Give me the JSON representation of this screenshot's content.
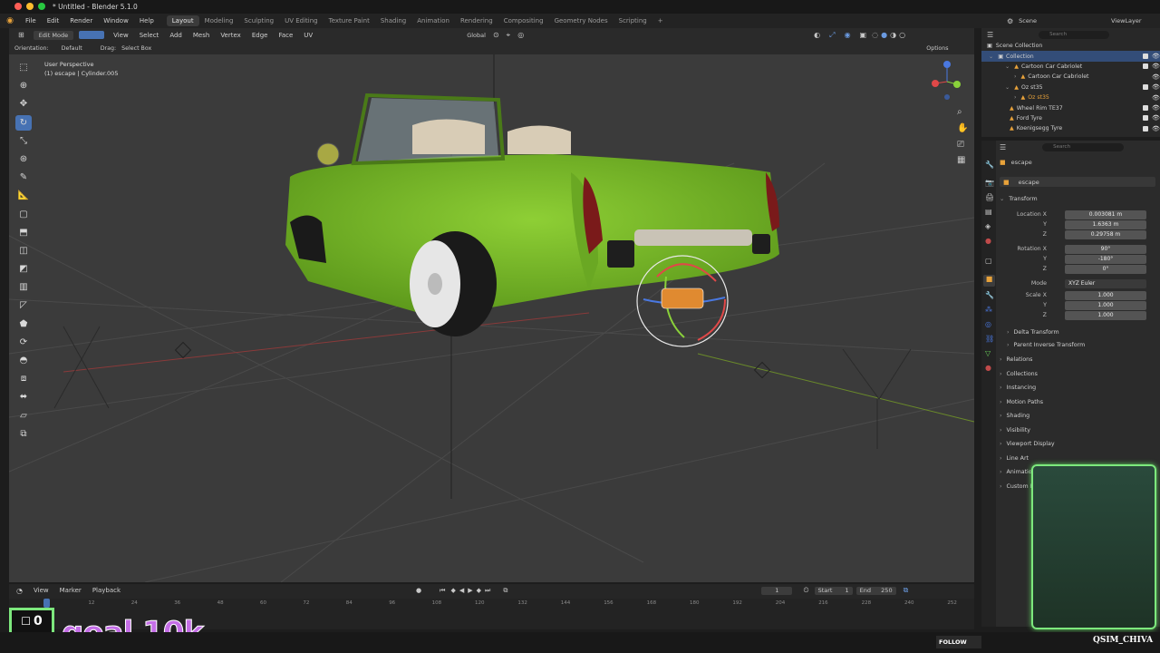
{
  "window": {
    "title": "* Untitled - Blender 5.1.0"
  },
  "menubar": {
    "menus": [
      "File",
      "Edit",
      "Render",
      "Window",
      "Help"
    ],
    "workspaces": [
      "Layout",
      "Modeling",
      "Sculpting",
      "UV Editing",
      "Texture Paint",
      "Shading",
      "Animation",
      "Rendering",
      "Compositing",
      "Geometry Nodes",
      "Scripting"
    ],
    "active_workspace": "Layout",
    "add_tab": "+",
    "scene": "Scene",
    "view_layer": "ViewLayer"
  },
  "viewport_header": {
    "mode": "Edit Mode",
    "menus": [
      "View",
      "Select",
      "Add",
      "Mesh",
      "Vertex",
      "Edge",
      "Face",
      "UV"
    ],
    "orientation": "Global",
    "orientation_label": "Orientation:",
    "orientation_value": "Default",
    "drag_label": "Drag:",
    "drag_value": "Select Box",
    "options": "Options"
  },
  "viewport": {
    "perspective": "User Perspective",
    "object_info": "(1) escape | Cylinder.005",
    "colors": {
      "background": "#3b3b3b",
      "car": "#7ab82a"
    }
  },
  "outliner": {
    "search_placeholder": "Search",
    "root": "Scene Collection",
    "items": [
      {
        "label": "Collection",
        "level": 0,
        "icon": "collection-icon"
      },
      {
        "label": "Cartoon Car Cabriolet",
        "level": 1,
        "icon": "object-icon"
      },
      {
        "label": "Cartoon Car Cabriolet",
        "level": 2,
        "icon": "mesh-icon"
      },
      {
        "label": "Oz st35",
        "level": 1,
        "icon": "object-icon"
      },
      {
        "label": "Oz st35",
        "level": 2,
        "icon": "mesh-icon"
      },
      {
        "label": "Wheel Rim TE37",
        "level": 1,
        "icon": "object-icon"
      },
      {
        "label": "Ford Tyre",
        "level": 1,
        "icon": "object-icon"
      },
      {
        "label": "Koenigsegg Tyre",
        "level": 1,
        "icon": "object-icon"
      }
    ]
  },
  "properties": {
    "search_placeholder": "Search",
    "object_name": "escape",
    "object_field": "escape",
    "transform": {
      "title": "Transform",
      "location_label": "Location X",
      "location": [
        "0.003081 m",
        "1.6363 m",
        "0.29758 m"
      ],
      "rotation_label": "Rotation X",
      "rotation": [
        "90°",
        "-180°",
        "0°"
      ],
      "mode_label": "Mode",
      "mode": "XYZ Euler",
      "scale_label": "Scale X",
      "scale": [
        "1.000",
        "1.000",
        "1.000"
      ],
      "y_label": "Y",
      "z_label": "Z",
      "subsections": [
        "Delta Transform",
        "Parent Inverse Transform"
      ]
    },
    "sections": [
      "Relations",
      "Collections",
      "Instancing",
      "Motion Paths",
      "Shading",
      "Visibility",
      "Viewport Display",
      "Line Art",
      "Animation",
      "Custom Properties"
    ]
  },
  "timeline": {
    "menus": [
      "View",
      "Marker",
      "Playback"
    ],
    "current_frame": "1",
    "start_label": "Start",
    "start": "1",
    "end_label": "End",
    "end": "250",
    "ticks": [
      "0",
      "12",
      "24",
      "36",
      "48",
      "60",
      "72",
      "84",
      "96",
      "108",
      "120",
      "132",
      "144",
      "156",
      "168",
      "180",
      "192",
      "204",
      "216",
      "228",
      "240",
      "252"
    ]
  },
  "overlay": {
    "goal_text": "goal 10k",
    "counter": "0",
    "follow": "FOLLOW",
    "streamer": "QSIM_CHIVA"
  }
}
